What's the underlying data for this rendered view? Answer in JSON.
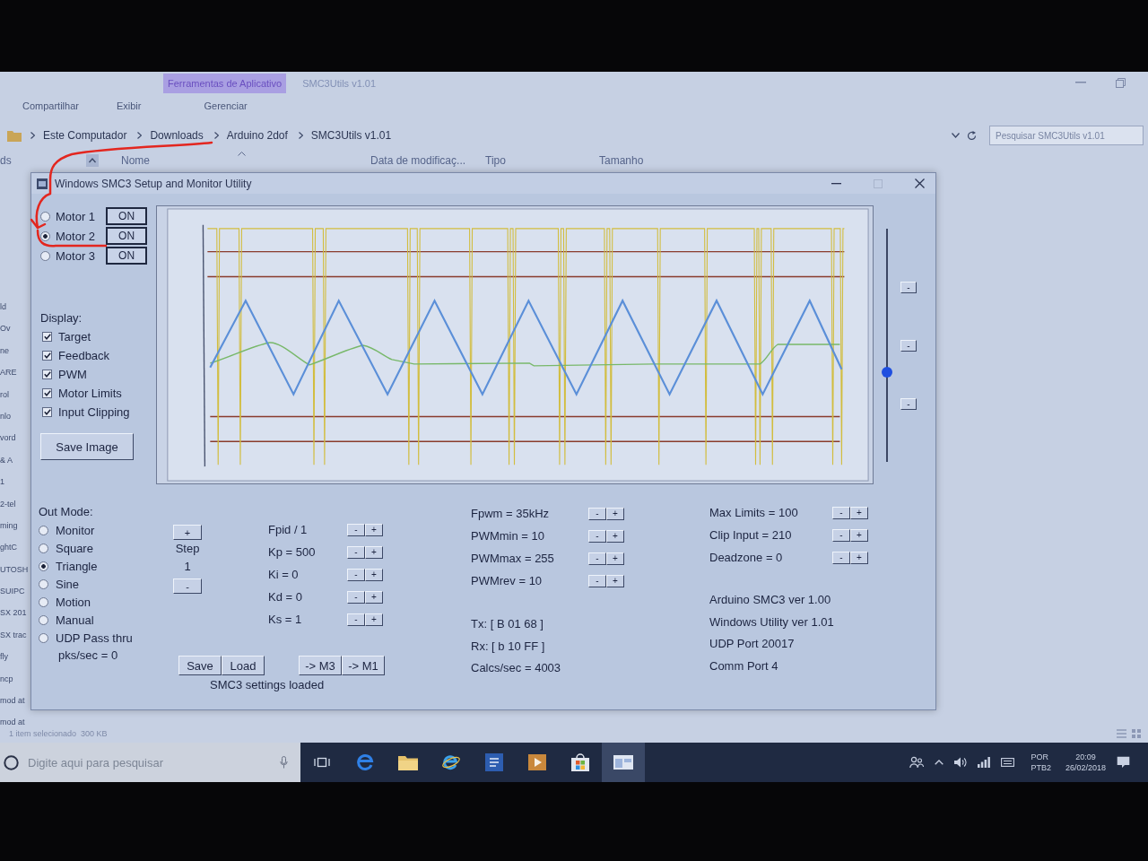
{
  "explorer": {
    "context_tab": "Ferramentas de Aplicativo",
    "title": "SMC3Utils v1.01",
    "ribbon_tabs": [
      "Compartilhar",
      "Exibir",
      "Gerenciar"
    ],
    "breadcrumb": [
      "Este Computador",
      "Downloads",
      "Arduino 2dof",
      "SMC3Utils v1.01"
    ],
    "search": {
      "placeholder": "Pesquisar SMC3Utils v1.01"
    },
    "nav_header": "ds",
    "columns": [
      "Nome",
      "Data de modificaç...",
      "Tipo",
      "Tamanho"
    ],
    "nav_items": [
      "ld",
      "Ov",
      "ne",
      "ARE",
      "rol",
      "nlo",
      "vord",
      "& A",
      "1",
      "2-tel",
      "ming",
      "ghtC",
      "UTOSH",
      "SUIPC",
      "SX 201",
      "SX trac",
      "fly",
      "ncp",
      "mod at",
      "mod at"
    ],
    "status": "1 item selecionado  300 KB"
  },
  "window": {
    "title": "Windows SMC3 Setup and Monitor Utility",
    "motors": [
      {
        "label": "Motor 1",
        "selected": false,
        "button": "ON"
      },
      {
        "label": "Motor 2",
        "selected": true,
        "button": "ON"
      },
      {
        "label": "Motor 3",
        "selected": false,
        "button": "ON"
      }
    ],
    "display": {
      "heading": "Display:",
      "options": [
        {
          "label": "Target",
          "checked": true
        },
        {
          "label": "Feedback",
          "checked": true
        },
        {
          "label": "PWM",
          "checked": true
        },
        {
          "label": "Motor Limits",
          "checked": true
        },
        {
          "label": "Input Clipping",
          "checked": true
        }
      ]
    },
    "save_image": "Save Image",
    "slider": {
      "level": 0.38
    },
    "side_buttons": [
      "-",
      "-",
      "-"
    ],
    "out_mode": {
      "heading": "Out Mode:",
      "options": [
        {
          "label": "Monitor",
          "selected": false
        },
        {
          "label": "Square",
          "selected": false
        },
        {
          "label": "Triangle",
          "selected": true
        },
        {
          "label": "Sine",
          "selected": false
        },
        {
          "label": "Motion",
          "selected": false
        },
        {
          "label": "Manual",
          "selected": false
        },
        {
          "label": "UDP Pass thru",
          "selected": false
        }
      ],
      "rate": "pks/sec = 0"
    },
    "step": {
      "increase": "+",
      "label": "Step",
      "value": "1",
      "decrease": "-"
    },
    "pid": [
      {
        "label": "Fpid / 1",
        "decrease": "-",
        "increase": "+"
      },
      {
        "label": "Kp = 500",
        "decrease": "-",
        "increase": "+"
      },
      {
        "label": "Ki = 0",
        "decrease": "-",
        "increase": "+"
      },
      {
        "label": "Kd = 0",
        "decrease": "-",
        "increase": "+"
      },
      {
        "label": "Ks = 1",
        "decrease": "-",
        "increase": "+"
      }
    ],
    "file_buttons": [
      "Save",
      "Load"
    ],
    "copy_buttons": [
      "-> M3",
      "-> M1"
    ],
    "settings_status": "SMC3 settings loaded",
    "pwm": [
      {
        "label": "Fpwm = 35kHz",
        "decrease": "-",
        "increase": "+"
      },
      {
        "label": "PWMmin = 10",
        "decrease": "-",
        "increase": "+"
      },
      {
        "label": "PWMmax = 255",
        "decrease": "-",
        "increase": "+"
      },
      {
        "label": "PWMrev = 10",
        "decrease": "-",
        "increase": "+"
      }
    ],
    "comms": [
      "Tx: [ B 01 68 ]",
      "Rx: [ b 10 FF ]",
      "Calcs/sec = 4003"
    ],
    "limits": [
      {
        "label": "Max Limits = 100",
        "decrease": "-",
        "increase": "+"
      },
      {
        "label": "Clip Input = 210",
        "decrease": "-",
        "increase": "+"
      },
      {
        "label": "Deadzone = 0",
        "decrease": "-",
        "increase": "+"
      }
    ],
    "info": [
      "Arduino SMC3 ver 1.00",
      "Windows Utility ver 1.01",
      "UDP Port 20017",
      "Comm Port 4"
    ]
  },
  "taskbar": {
    "search": {
      "placeholder": "Digite aqui para pesquisar"
    },
    "apps": [
      {
        "kind": "task-view",
        "selected": false
      },
      {
        "kind": "edge",
        "selected": false
      },
      {
        "kind": "explorer",
        "selected": false
      },
      {
        "kind": "ie",
        "selected": false
      },
      {
        "kind": "word",
        "selected": false
      },
      {
        "kind": "media",
        "selected": false
      },
      {
        "kind": "store",
        "selected": false
      },
      {
        "kind": "app",
        "selected": true
      }
    ],
    "language": [
      "POR",
      "PTB2"
    ],
    "time": "20:09",
    "date": "26/02/2018"
  }
}
